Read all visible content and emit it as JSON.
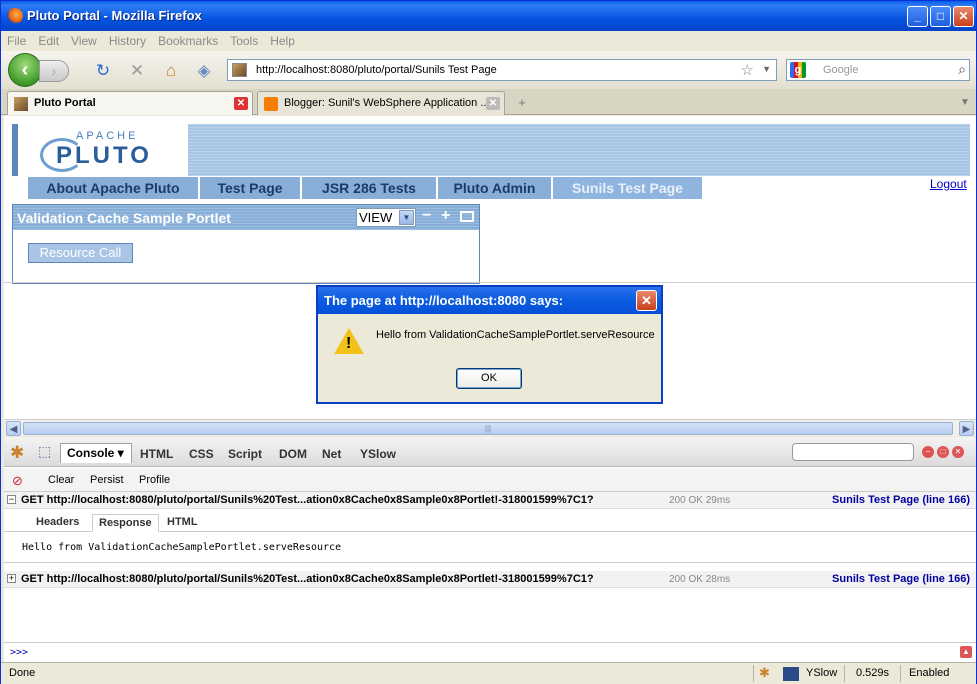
{
  "window": {
    "title": "Pluto Portal - Mozilla Firefox"
  },
  "menu": [
    "File",
    "Edit",
    "View",
    "History",
    "Bookmarks",
    "Tools",
    "Help"
  ],
  "nav": {
    "url": "http://localhost:8080/pluto/portal/Sunils Test Page",
    "search_placeholder": "Google"
  },
  "tabs": [
    {
      "label": "Pluto Portal"
    },
    {
      "label": "Blogger: Sunil's WebSphere Application ..."
    }
  ],
  "page": {
    "logo_apache": "APACHE",
    "logo_pluto": "PLUTO",
    "nav_tabs": [
      "About Apache Pluto",
      "Test Page",
      "JSR 286 Tests",
      "Pluto Admin",
      "Sunils Test Page"
    ],
    "logout": "Logout",
    "portlet": {
      "title": "Validation Cache Sample Portlet",
      "mode": "VIEW",
      "button": "Resource Call"
    }
  },
  "dialog": {
    "title": "The page at http://localhost:8080 says:",
    "message": "Hello from ValidationCacheSamplePortlet.serveResource",
    "ok": "OK"
  },
  "firebug": {
    "tabs": [
      "Console",
      "HTML",
      "CSS",
      "Script",
      "DOM",
      "Net",
      "YSlow"
    ],
    "toolbar": [
      "Clear",
      "Persist",
      "Profile"
    ],
    "requests": [
      {
        "toggle": "−",
        "url": "GET http://localhost:8080/pluto/portal/Sunils%20Test...ation0x8Cache0x8Sample0x8Portlet!-318001599%7C1?",
        "status": "200 OK 29ms",
        "source": "Sunils Test Page (line 166)"
      },
      {
        "toggle": "+",
        "url": "GET http://localhost:8080/pluto/portal/Sunils%20Test...ation0x8Cache0x8Sample0x8Portlet!-318001599%7C1?",
        "status": "200 OK 28ms",
        "source": "Sunils Test Page (line 166)"
      }
    ],
    "response_tabs": [
      "Headers",
      "Response",
      "HTML"
    ],
    "response_text": "Hello from ValidationCacheSamplePortlet.serveResource",
    "prompt": ">>>"
  },
  "status": {
    "text": "Done",
    "yslow": "YSlow",
    "time": "0.529s",
    "enabled": "Enabled"
  }
}
